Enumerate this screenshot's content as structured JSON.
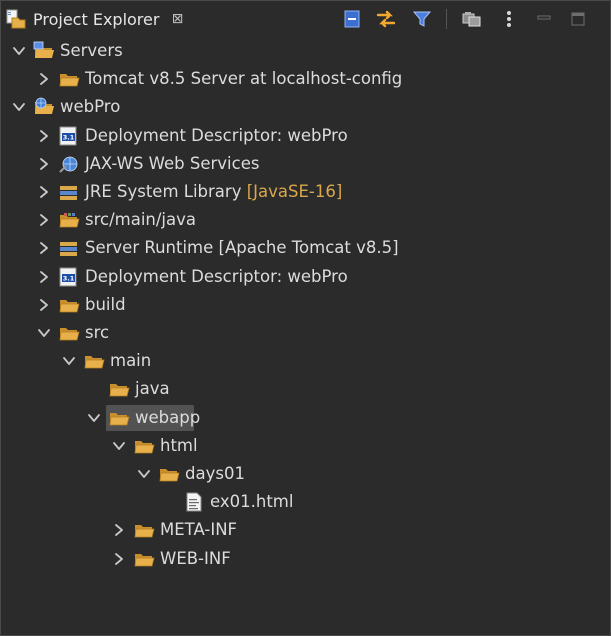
{
  "view": {
    "title": "Project Explorer",
    "close_glyph": "⊠",
    "icons": [
      "project-explorer-icon",
      "collapse-all-icon",
      "link-with-editor-icon",
      "filter-icon",
      "select-working-set-icon",
      "view-menu-icon",
      "minimize-icon",
      "maximize-icon"
    ]
  },
  "colors": {
    "background": "#2b2b2b",
    "text": "#dcdcdc",
    "decoration": "#d9a84a",
    "selection": "#525252",
    "folder": "#e8b04b"
  },
  "tree": [
    {
      "label": "Servers",
      "decoration": "",
      "expanded": true,
      "depth": 0,
      "icon": "server-folder-icon"
    },
    {
      "label": "Tomcat v8.5 Server at localhost-config",
      "decoration": "",
      "expanded": false,
      "depth": 1,
      "icon": "folder-icon"
    },
    {
      "label": "webPro",
      "decoration": "",
      "expanded": true,
      "depth": 0,
      "icon": "web-project-icon"
    },
    {
      "label": "Deployment Descriptor: webPro",
      "decoration": "",
      "expanded": false,
      "depth": 1,
      "icon": "deployment-descriptor-icon"
    },
    {
      "label": "JAX-WS Web Services",
      "decoration": "",
      "expanded": false,
      "depth": 1,
      "icon": "web-services-icon"
    },
    {
      "label": "JRE System Library ",
      "decoration": "[JavaSE-16]",
      "expanded": false,
      "depth": 1,
      "icon": "library-icon"
    },
    {
      "label": "src/main/java",
      "decoration": "",
      "expanded": false,
      "depth": 1,
      "icon": "source-folder-icon"
    },
    {
      "label": "Server Runtime [Apache Tomcat v8.5]",
      "decoration": "",
      "expanded": false,
      "depth": 1,
      "icon": "library-icon"
    },
    {
      "label": "Deployment Descriptor: webPro",
      "decoration": "",
      "expanded": false,
      "depth": 1,
      "icon": "deployment-descriptor-icon"
    },
    {
      "label": "build",
      "decoration": "",
      "expanded": false,
      "depth": 1,
      "icon": "folder-icon"
    },
    {
      "label": "src",
      "decoration": "",
      "expanded": true,
      "depth": 1,
      "icon": "folder-icon"
    },
    {
      "label": "main",
      "decoration": "",
      "expanded": true,
      "depth": 2,
      "icon": "folder-icon"
    },
    {
      "label": "java",
      "decoration": "",
      "expanded": null,
      "depth": 3,
      "icon": "folder-icon"
    },
    {
      "label": "webapp",
      "decoration": "",
      "expanded": true,
      "depth": 3,
      "icon": "folder-icon",
      "selected": true
    },
    {
      "label": "html",
      "decoration": "",
      "expanded": true,
      "depth": 4,
      "icon": "folder-icon"
    },
    {
      "label": "days01",
      "decoration": "",
      "expanded": true,
      "depth": 5,
      "icon": "folder-icon"
    },
    {
      "label": "ex01.html",
      "decoration": "",
      "expanded": null,
      "depth": 6,
      "icon": "html-file-icon"
    },
    {
      "label": "META-INF",
      "decoration": "",
      "expanded": false,
      "depth": 4,
      "icon": "folder-icon"
    },
    {
      "label": "WEB-INF",
      "decoration": "",
      "expanded": false,
      "depth": 4,
      "icon": "folder-icon"
    }
  ]
}
